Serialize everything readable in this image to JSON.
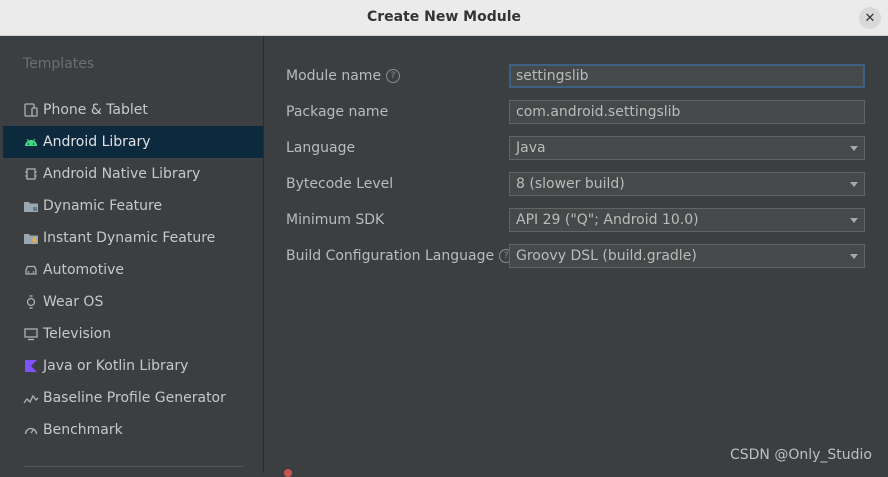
{
  "window": {
    "title": "Create New Module",
    "close_icon": "✕"
  },
  "sidebar": {
    "heading": "Templates",
    "items": [
      {
        "label": "Phone & Tablet",
        "icon": "phone-tablet-icon"
      },
      {
        "label": "Android Library",
        "icon": "android-icon",
        "selected": true
      },
      {
        "label": "Android Native Library",
        "icon": "native-library-icon"
      },
      {
        "label": "Dynamic Feature",
        "icon": "dynamic-feature-icon"
      },
      {
        "label": "Instant Dynamic Feature",
        "icon": "instant-dynamic-feature-icon"
      },
      {
        "label": "Automotive",
        "icon": "car-icon"
      },
      {
        "label": "Wear OS",
        "icon": "watch-icon"
      },
      {
        "label": "Television",
        "icon": "tv-icon"
      },
      {
        "label": "Java or Kotlin Library",
        "icon": "kotlin-icon"
      },
      {
        "label": "Baseline Profile Generator",
        "icon": "baseline-profile-icon"
      },
      {
        "label": "Benchmark",
        "icon": "benchmark-icon"
      }
    ]
  },
  "form": {
    "module_name": {
      "label": "Module name",
      "value": "settingslib"
    },
    "package_name": {
      "label": "Package name",
      "value": "com.android.settingslib"
    },
    "language": {
      "label": "Language",
      "value": "Java"
    },
    "bytecode_level": {
      "label": "Bytecode Level",
      "value": "8 (slower build)"
    },
    "minimum_sdk": {
      "label": "Minimum SDK",
      "value": "API 29 (\"Q\"; Android 10.0)"
    },
    "build_config_language": {
      "label": "Build Configuration Language",
      "value": "Groovy DSL (build.gradle)"
    }
  },
  "watermark": "CSDN @Only_Studio",
  "colors": {
    "background": "#3c3f41",
    "selection": "#0d293e",
    "android_green": "#3ddc84",
    "kotlin_purple": "#7f52ff",
    "focus_border": "#3d6185"
  }
}
